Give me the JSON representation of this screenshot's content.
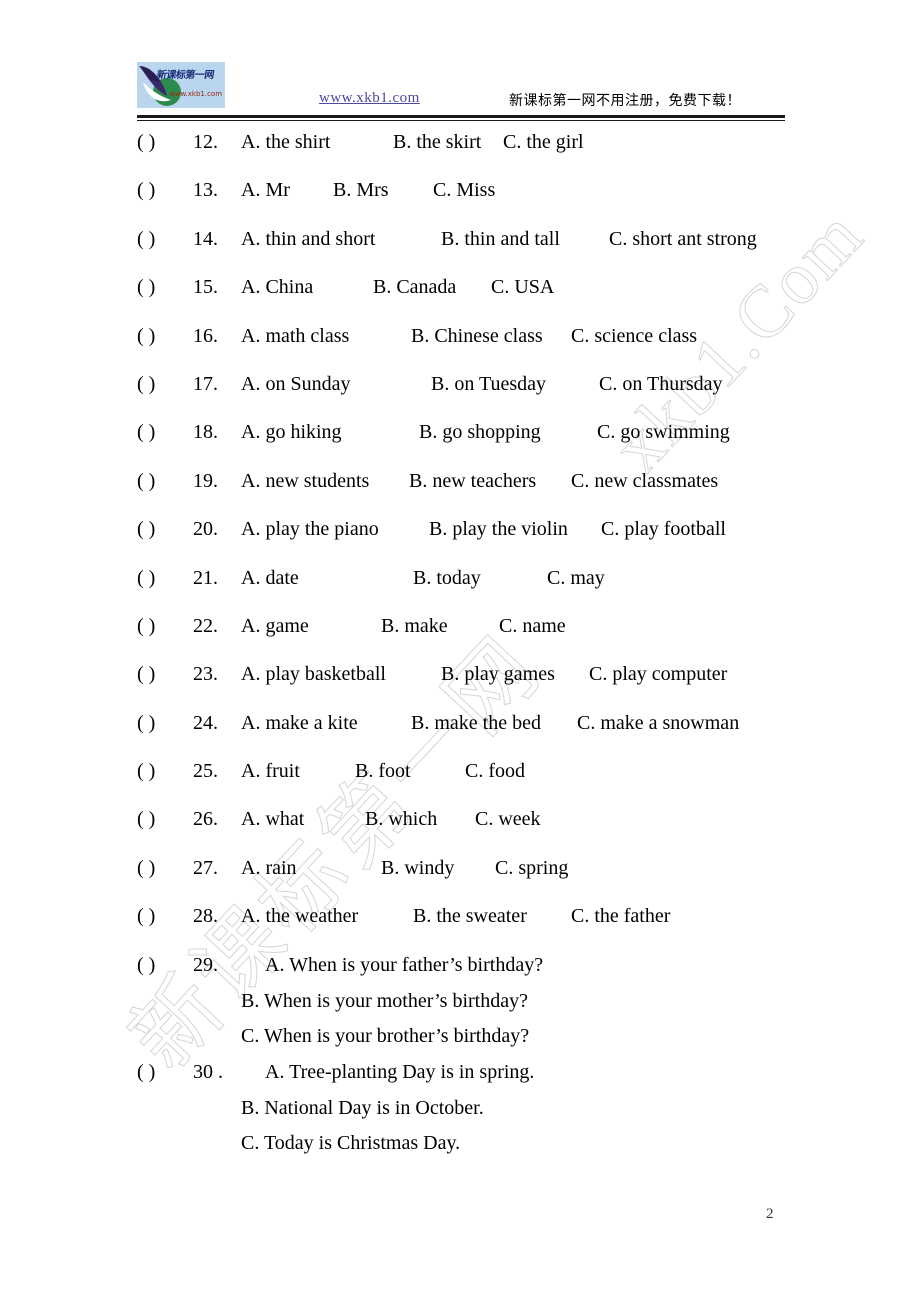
{
  "header": {
    "logo_text": "新课标第一网",
    "logo_url": "www.xkb1.com",
    "link": "www.xkb1.com",
    "promo_cn": "新课标第一网不用注册，免费下载！"
  },
  "watermarks": {
    "top_right": "xkb1.Com",
    "bottom_left": "新课标第一网"
  },
  "footer": {
    "page_number": "2"
  },
  "questions": [
    {
      "paren": "(        )",
      "number": "12.",
      "options": [
        "A. the shirt",
        "B. the skirt",
        "C. the girl"
      ],
      "offsets": [
        0,
        152,
        262
      ],
      "sub_lines": []
    },
    {
      "paren": "(        )",
      "number": "13.",
      "options": [
        "A. Mr",
        "B. Mrs",
        "C. Miss"
      ],
      "offsets": [
        0,
        92,
        192
      ],
      "sub_lines": []
    },
    {
      "paren": "(        )",
      "number": "14.",
      "options": [
        "A. thin and short",
        "B. thin and tall",
        "C. short ant strong"
      ],
      "offsets": [
        0,
        200,
        368
      ],
      "sub_lines": []
    },
    {
      "paren": "(        )",
      "number": "15.",
      "options": [
        "A. China",
        "B. Canada",
        "C. USA"
      ],
      "offsets": [
        0,
        132,
        250
      ],
      "sub_lines": []
    },
    {
      "paren": "(        )",
      "number": "16.",
      "options": [
        "A. math class",
        "B. Chinese class",
        "C. science class"
      ],
      "offsets": [
        0,
        170,
        330
      ],
      "sub_lines": []
    },
    {
      "paren": "(        )",
      "number": "17.",
      "options": [
        "A. on Sunday",
        "B. on Tuesday",
        "C. on Thursday"
      ],
      "offsets": [
        0,
        190,
        358
      ],
      "sub_lines": []
    },
    {
      "paren": "(        )",
      "number": "18.",
      "options": [
        "A. go hiking",
        "B. go shopping",
        "C. go swimming"
      ],
      "offsets": [
        0,
        178,
        356
      ],
      "sub_lines": []
    },
    {
      "paren": "(        )",
      "number": "19.",
      "options": [
        "A.   new students",
        "B.   new teachers",
        "C.   new classmates"
      ],
      "offsets": [
        0,
        168,
        330
      ],
      "sub_lines": []
    },
    {
      "paren": "(        )",
      "number": "20.",
      "options": [
        "A. play the piano",
        "B. play the violin",
        "C. play football"
      ],
      "offsets": [
        0,
        188,
        360
      ],
      "sub_lines": []
    },
    {
      "paren": "(        )",
      "number": "21.",
      "options": [
        "A.   date",
        "B. today",
        "C.   may"
      ],
      "offsets": [
        0,
        172,
        306
      ],
      "sub_lines": []
    },
    {
      "paren": "(        )",
      "number": "22.",
      "options": [
        "A. game",
        "B. make",
        "C. name"
      ],
      "offsets": [
        0,
        140,
        258
      ],
      "sub_lines": []
    },
    {
      "paren": "(        )",
      "number": "23.",
      "options": [
        "A. play basketball",
        "B. play games",
        "C. play computer"
      ],
      "offsets": [
        0,
        200,
        348
      ],
      "sub_lines": []
    },
    {
      "paren": "(        )",
      "number": "24.",
      "options": [
        "A. make a kite",
        "B. make the bed",
        "C. make a snowman"
      ],
      "offsets": [
        0,
        170,
        336
      ],
      "sub_lines": []
    },
    {
      "paren": "(        )",
      "number": "25.",
      "options": [
        "A. fruit",
        "B. foot",
        "C. food"
      ],
      "offsets": [
        0,
        114,
        224
      ],
      "sub_lines": []
    },
    {
      "paren": "(        )",
      "number": "26.",
      "options": [
        "A. what",
        "B. which",
        "C. week"
      ],
      "offsets": [
        0,
        124,
        234
      ],
      "sub_lines": []
    },
    {
      "paren": "(        )",
      "number": "27.",
      "options": [
        "A. rain",
        "B. windy",
        "C. spring"
      ],
      "offsets": [
        0,
        140,
        254
      ],
      "sub_lines": []
    },
    {
      "paren": "(        )",
      "number": "28.",
      "options": [
        "A. the weather",
        "B. the sweater",
        "C. the father"
      ],
      "offsets": [
        0,
        172,
        330
      ],
      "sub_lines": []
    },
    {
      "paren": "(        )",
      "number": "29.",
      "options": [
        "A. When is your father’s birthday?"
      ],
      "offsets": [
        24
      ],
      "sub_lines": [
        "B. When is your mother’s birthday?",
        "C. When is your brother’s birthday?"
      ]
    },
    {
      "paren": "(        )",
      "number": "30 .",
      "options": [
        "A. Tree-planting Day is in spring."
      ],
      "offsets": [
        24
      ],
      "sub_lines": [
        "B. National Day is in October.",
        "C. Today is Christmas Day."
      ]
    }
  ]
}
